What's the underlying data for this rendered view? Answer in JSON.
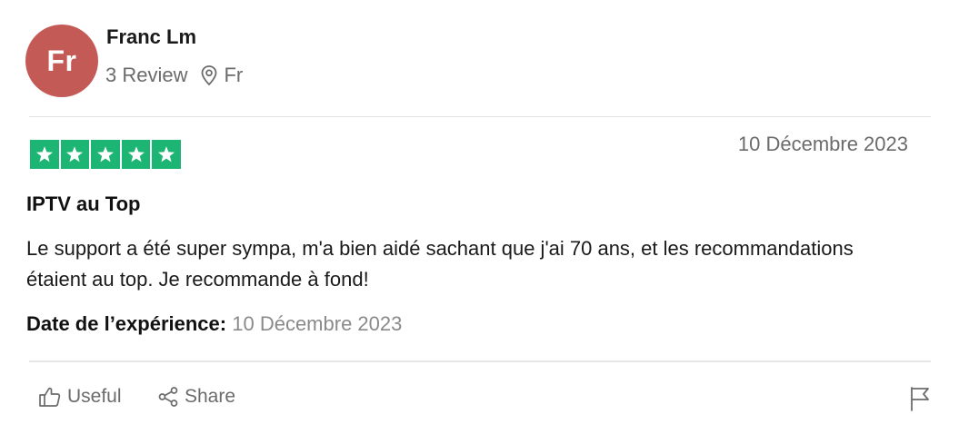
{
  "reviewer": {
    "initials": "Fr",
    "name": "Franc Lm",
    "review_count": "3 Review",
    "location": "Fr",
    "avatar_color": "#c45a56"
  },
  "review": {
    "rating": 5,
    "rating_max": 5,
    "star_color": "#1db573",
    "date": "10 Décembre 2023",
    "title": "IPTV au Top",
    "body": "Le support a été super sympa, m'a bien aidé sachant que j'ai 70 ans, et les recommandations étaient au top. Je recommande à fond!",
    "experience_label": "Date de l’expérience:",
    "experience_date": "10 Décembre 2023"
  },
  "actions": {
    "useful_label": "Useful",
    "share_label": "Share",
    "useful_icon": "thumbs-up-icon",
    "share_icon": "share-icon",
    "report_icon": "flag-icon"
  }
}
